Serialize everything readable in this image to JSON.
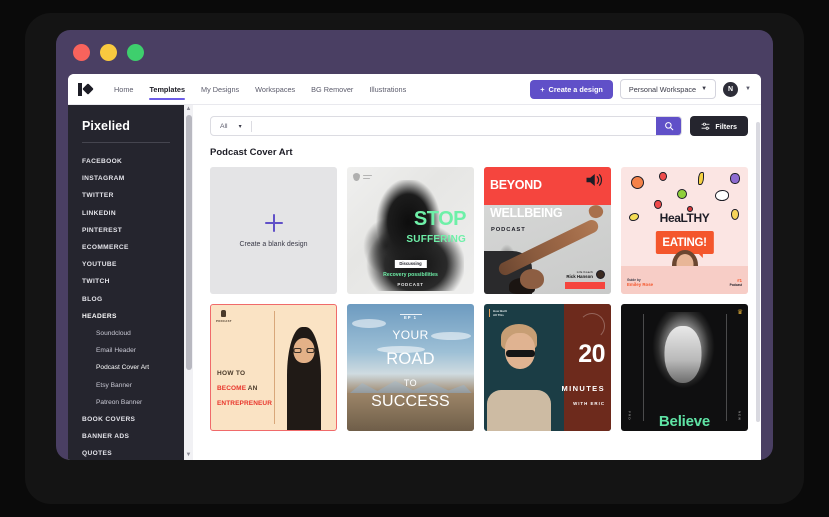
{
  "window": {
    "traffic_lights": [
      "close",
      "minimize",
      "maximize"
    ]
  },
  "topnav": {
    "logo_name": "pixelied-logo",
    "links": [
      {
        "label": "Home",
        "active": false
      },
      {
        "label": "Templates",
        "active": true
      },
      {
        "label": "My Designs",
        "active": false
      },
      {
        "label": "Workspaces",
        "active": false
      },
      {
        "label": "BG Remover",
        "active": false
      },
      {
        "label": "Illustrations",
        "active": false
      }
    ],
    "create_button": "Create a design",
    "create_button_icon": "plus-icon",
    "workspace": "Personal Workspace",
    "workspace_chevron": "▼",
    "avatar_initial": "N",
    "avatar_chevron": "▼"
  },
  "sidebar": {
    "brand": "Pixelied",
    "items": [
      {
        "label": "FACEBOOK",
        "type": "category",
        "selected": false
      },
      {
        "label": "INSTAGRAM",
        "type": "category",
        "selected": false
      },
      {
        "label": "TWITTER",
        "type": "category",
        "selected": false
      },
      {
        "label": "LINKEDIN",
        "type": "category",
        "selected": false
      },
      {
        "label": "PINTEREST",
        "type": "category",
        "selected": false
      },
      {
        "label": "ECOMMERCE",
        "type": "category",
        "selected": false
      },
      {
        "label": "YOUTUBE",
        "type": "category",
        "selected": false
      },
      {
        "label": "TWITCH",
        "type": "category",
        "selected": false
      },
      {
        "label": "BLOG",
        "type": "category",
        "selected": false
      },
      {
        "label": "HEADERS",
        "type": "category",
        "selected": true
      },
      {
        "label": "Soundcloud",
        "type": "sub",
        "selected": false
      },
      {
        "label": "Email Header",
        "type": "sub",
        "selected": false
      },
      {
        "label": "Podcast Cover Art",
        "type": "sub",
        "selected": true
      },
      {
        "label": "Etsy Banner",
        "type": "sub",
        "selected": false
      },
      {
        "label": "Patreon Banner",
        "type": "sub",
        "selected": false
      },
      {
        "label": "BOOK COVERS",
        "type": "category",
        "selected": false
      },
      {
        "label": "BANNER ADS",
        "type": "category",
        "selected": false
      },
      {
        "label": "QUOTES",
        "type": "category",
        "selected": false
      }
    ],
    "scroll_up_icon": "▲",
    "scroll_down_icon": "▼"
  },
  "search": {
    "filter_label": "All",
    "filter_chevron": "▾",
    "value": "",
    "placeholder": "",
    "search_icon": "magnifier-icon",
    "filters_label": "Filters",
    "filters_icon": "sliders-icon"
  },
  "main": {
    "section_title": "Podcast Cover Art"
  },
  "cards": [
    {
      "name": "create-blank-design",
      "kind": "blank",
      "label": "Create a blank design",
      "icon": "plus-icon"
    },
    {
      "name": "stop-suffering",
      "kind": "template",
      "badge": "shield-logo",
      "title_line1": "STOP",
      "title_line2": "SUFFERING",
      "tag": "Discussing",
      "subtitle": "Recovery possibilities",
      "footer": "PODCAST"
    },
    {
      "name": "beyond-wellbeing",
      "kind": "template",
      "title_line1": "BEYOND",
      "title_line2": "WELLBEING",
      "label": "PODCAST",
      "host_role": "Life Coach",
      "host_name": "Rick Hanson",
      "icon": "megaphone-icon"
    },
    {
      "name": "healthy-eating",
      "kind": "template",
      "title_line1": "HeaLTHY",
      "title_line2": "EATING!",
      "guide_label": "Guide by",
      "guide_name": "Emiley Rose",
      "rank": "#1",
      "rank_label": "Podcast"
    },
    {
      "name": "how-to-become-an-entrepreneur",
      "kind": "template",
      "badge_label": "PODCAST",
      "title_line1": "HOW TO",
      "title_line2_strong": "BECOME",
      "title_line2_rest": " AN",
      "title_line3": "ENTREPRENEUR"
    },
    {
      "name": "your-road-to-success",
      "kind": "template",
      "eyebrow": "EP 1",
      "title_line1": "YOUR",
      "title_line2": "ROAD",
      "title_line3": "TO",
      "title_line4": "SUCCESS"
    },
    {
      "name": "20-minutes-with-eric",
      "kind": "template",
      "badge_line1": "How Built",
      "badge_line2": "All This",
      "number": "20",
      "unit": "MINUTES",
      "host": "WITH ERIC"
    },
    {
      "name": "believe",
      "kind": "template",
      "title": "Believe",
      "premium_icon": "crown-icon",
      "side_left": "PRO",
      "side_right": "NEW"
    }
  ],
  "colors": {
    "accent_purple": "#6050c8",
    "frame_purple": "#4a3f63",
    "sidebar_dark": "#25252e",
    "red": "#f5453e",
    "green_mint": "#6ef0a8",
    "orange": "#f4562c"
  }
}
